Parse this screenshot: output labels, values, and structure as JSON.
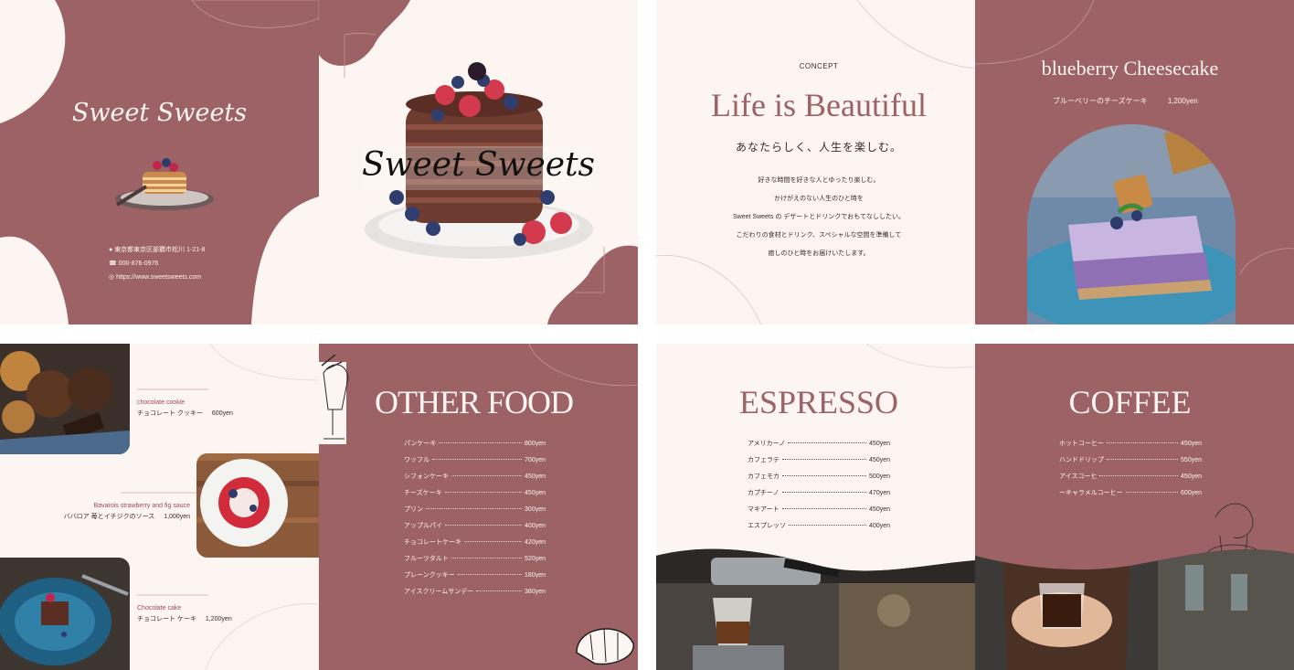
{
  "colors": {
    "mauve": "#9c6265",
    "cream": "#fdf5f1",
    "text_dark": "#3a2a2a",
    "accent_red": "#a1475a"
  },
  "cover": {
    "brand": "Sweet Sweets",
    "address": "東京都東京区部覇市松川 1-21-8",
    "phone": "000-876-0976",
    "url": "https://www.sweetsweets.com",
    "icons": [
      "map-pin-icon",
      "phone-icon",
      "globe-icon"
    ]
  },
  "hero": {
    "title": "Sweet Sweets"
  },
  "concept": {
    "label": "CONCEPT",
    "headline": "Life is Beautiful",
    "subhead": "あなたらしく、人生を楽しむ。",
    "body": [
      "好きな時間を好きな人とゆったり楽しむ。",
      "かけがえのない人生のひと時を",
      "Sweet Sweets の デザートとドリンクでおもてなししたい。",
      "こだわりの食材とドリンク、スペシャルな空間を準備して",
      "癒しのひと時をお届けいたします。"
    ]
  },
  "featured": {
    "title": "blueberry Cheesecake",
    "jp_name": "ブルーベリーのチーズケーキ",
    "price": "1,200yen"
  },
  "sweets_list": [
    {
      "en": "chocolate cookie",
      "jp": "チョコレート クッキー",
      "price": "600yen"
    },
    {
      "en": "Bavarois strawberry and fig sauce",
      "jp": "ババロア 苺とイチジクのソース",
      "price": "1,000yen"
    },
    {
      "en": "Chocolate cake",
      "jp": "チョコレート ケーキ",
      "price": "1,200yen"
    }
  ],
  "other_food": {
    "title": "OTHER FOOD",
    "items": [
      {
        "name": "パンケーキ",
        "price": "800yen"
      },
      {
        "name": "ワッフル",
        "price": "700yen"
      },
      {
        "name": "シフォンケーキ",
        "price": "450yen"
      },
      {
        "name": "チーズケーキ",
        "price": "450yen"
      },
      {
        "name": "プリン",
        "price": "300yen"
      },
      {
        "name": "アップルパイ",
        "price": "400yen"
      },
      {
        "name": "チョコレートケーキ",
        "price": "420yen"
      },
      {
        "name": "フルーツタルト",
        "price": "520yen"
      },
      {
        "name": "プレーンクッキー",
        "price": "180yen"
      },
      {
        "name": "アイスクリームサンデー",
        "price": "380yen"
      }
    ]
  },
  "espresso": {
    "title": "ESPRESSO",
    "items": [
      {
        "name": "アメリカーノ",
        "price": "450yen"
      },
      {
        "name": "カフェラテ",
        "price": "450yen"
      },
      {
        "name": "カフェモカ",
        "price": "500yen"
      },
      {
        "name": "カプチーノ",
        "price": "470yen"
      },
      {
        "name": "マキアート",
        "price": "450yen"
      },
      {
        "name": "エスプレッソ",
        "price": "400yen"
      }
    ]
  },
  "coffee": {
    "title": "COFFEE",
    "items": [
      {
        "name": "ホットコーヒー",
        "price": "450yen"
      },
      {
        "name": "ハンドドリップ",
        "price": "550yen"
      },
      {
        "name": "アイスコーヒ",
        "price": "450yen"
      },
      {
        "name": "ーキャラメルコーヒー",
        "price": "600yen"
      }
    ]
  }
}
